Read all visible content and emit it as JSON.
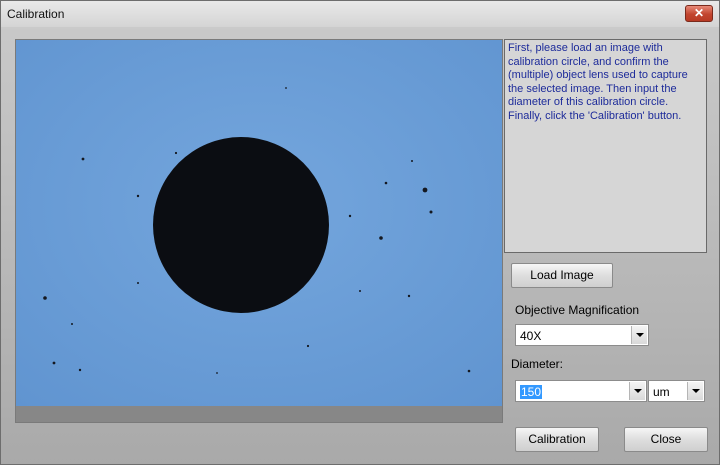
{
  "window": {
    "title": "Calibration",
    "close_glyph": "✕"
  },
  "info_text": "First, please load an image with calibration circle, and confirm the (multiple) object lens used to capture the selected image.  Then input the diameter of this calibration circle. Finally, click the 'Calibration' button.",
  "load_image_label": "Load Image",
  "objective": {
    "label": "Objective Magnification",
    "value": "40X"
  },
  "diameter": {
    "label": "Diameter:",
    "value": "150",
    "unit": "um"
  },
  "calibration_label": "Calibration",
  "close_label": "Close",
  "colors": {
    "image_background": "#6d9ed8",
    "circle": "#0b0d12",
    "frame": "#878787"
  },
  "icons": [
    "close-icon",
    "chevron-down-icon"
  ]
}
